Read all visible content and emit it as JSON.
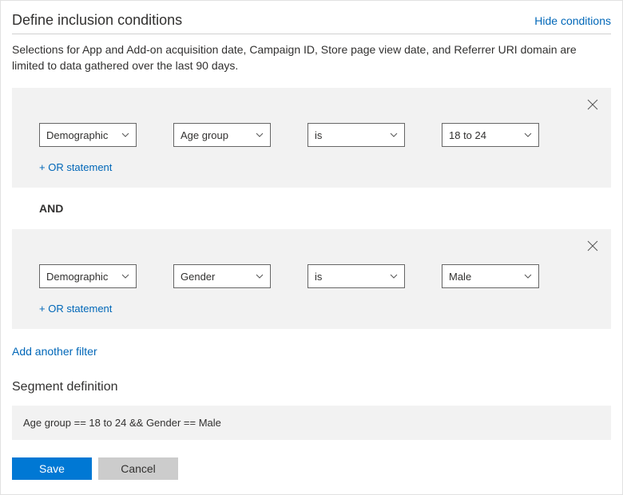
{
  "header": {
    "title": "Define inclusion conditions",
    "hide_link": "Hide conditions"
  },
  "description": "Selections for App and Add-on acquisition date, Campaign ID, Store page view date, and Referrer URI domain are limited to data gathered over the last 90 days.",
  "conditions": [
    {
      "category": "Demographic",
      "attribute": "Age group",
      "operator": "is",
      "value": "18 to 24",
      "or_label": "+ OR statement"
    },
    {
      "category": "Demographic",
      "attribute": "Gender",
      "operator": "is",
      "value": "Male",
      "or_label": "+ OR statement"
    }
  ],
  "and_label": "AND",
  "add_filter": "Add another filter",
  "segment": {
    "title": "Segment definition",
    "expression": "Age group == 18 to 24 && Gender == Male"
  },
  "buttons": {
    "save": "Save",
    "cancel": "Cancel"
  }
}
